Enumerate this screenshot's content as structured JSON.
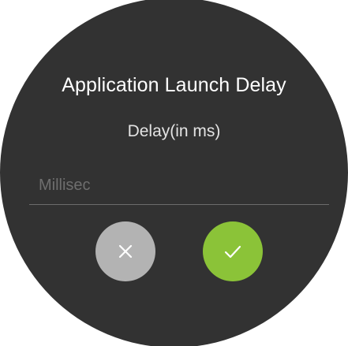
{
  "dialog": {
    "title": "Application Launch Delay",
    "subtitle": "Delay(in ms)",
    "input": {
      "value": "",
      "placeholder": "Millisec"
    },
    "buttons": {
      "cancel_icon": "close-icon",
      "confirm_icon": "check-icon"
    }
  },
  "colors": {
    "background": "#323232",
    "cancel": "#b3b3b3",
    "confirm": "#8bc338",
    "text": "#ffffff"
  }
}
